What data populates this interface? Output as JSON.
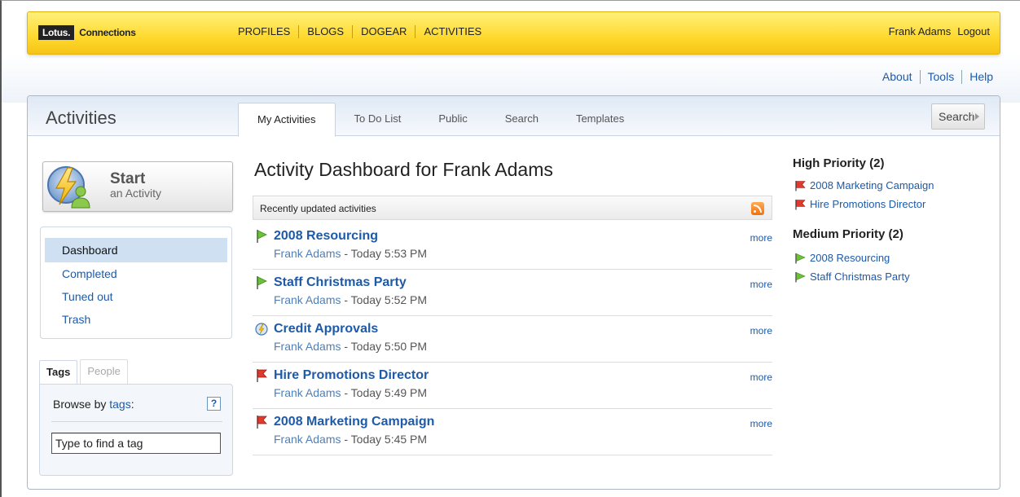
{
  "brand": {
    "logo_box": "Lotus.",
    "logo_text": "Connections"
  },
  "top_nav": [
    "PROFILES",
    "BLOGS",
    "DOGEAR",
    "ACTIVITIES"
  ],
  "user": {
    "name": "Frank Adams",
    "logout": "Logout"
  },
  "util_nav": [
    "About",
    "Tools",
    "Help"
  ],
  "app": {
    "title": "Activities"
  },
  "tabs": [
    "My Activities",
    "To Do List",
    "Public",
    "Search",
    "Templates"
  ],
  "active_tab": "My Activities",
  "search_button": "Search",
  "start_button": {
    "title": "Start",
    "subtitle": "an Activity"
  },
  "left_nav": [
    "Dashboard",
    "Completed",
    "Tuned out",
    "Trash"
  ],
  "tag_panel": {
    "tabs": [
      "Tags",
      "People"
    ],
    "browse_prefix": "Browse by",
    "browse_link": "tags",
    "browse_suffix": ":",
    "help": "?",
    "input_value": "Type to find a tag"
  },
  "dashboard": {
    "title": "Activity Dashboard for Frank Adams",
    "recent_label": "Recently updated activities",
    "more_label": "more",
    "activities": [
      {
        "title": "2008 Resourcing",
        "author": "Frank Adams",
        "time": " - Today 5:53 PM",
        "icon": "green-flag-icon"
      },
      {
        "title": "Staff Christmas Party",
        "author": "Frank Adams",
        "time": " - Today 5:52 PM",
        "icon": "green-flag-icon"
      },
      {
        "title": "Credit Approvals",
        "author": "Frank Adams",
        "time": " - Today 5:50 PM",
        "icon": "activity-bolt-icon"
      },
      {
        "title": "Hire Promotions Director",
        "author": "Frank Adams",
        "time": " - Today 5:49 PM",
        "icon": "red-flag-icon"
      },
      {
        "title": "2008 Marketing Campaign",
        "author": "Frank Adams",
        "time": " - Today 5:45 PM",
        "icon": "red-flag-icon"
      }
    ]
  },
  "priority": {
    "high": {
      "heading": "High Priority (2)",
      "items": [
        "2008 Marketing Campaign",
        "Hire Promotions Director"
      ]
    },
    "medium": {
      "heading": "Medium Priority (2)",
      "items": [
        "2008 Resourcing",
        "Staff Christmas Party"
      ]
    }
  },
  "colors": {
    "banner": "#ffd92e",
    "link": "#1d5aa8",
    "red_flag": "#d9342b",
    "green_flag": "#5cb82e"
  }
}
